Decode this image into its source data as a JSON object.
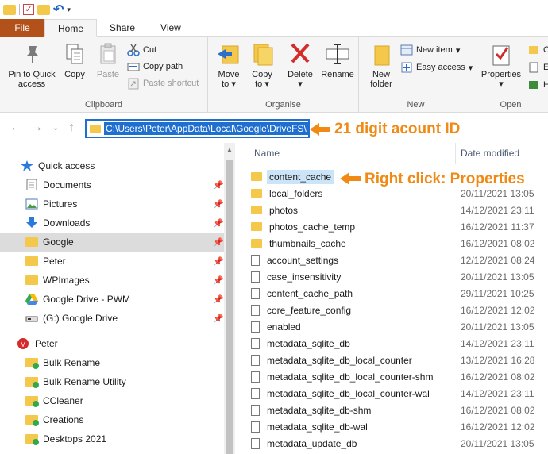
{
  "ribbon_tabs": {
    "file": "File",
    "home": "Home",
    "share": "Share",
    "view": "View"
  },
  "clipboard": {
    "pin_line1": "Pin to Quick",
    "pin_line2": "access",
    "copy": "Copy",
    "paste": "Paste",
    "cut": "Cut",
    "copy_path": "Copy path",
    "paste_shortcut": "Paste shortcut",
    "label": "Clipboard"
  },
  "organise": {
    "move_line1": "Move",
    "move_line2": "to",
    "copy_line1": "Copy",
    "copy_line2": "to",
    "delete": "Delete",
    "rename": "Rename",
    "label": "Organise"
  },
  "new_group": {
    "folder_line1": "New",
    "folder_line2": "folder",
    "new_item": "New item",
    "easy_access": "Easy access",
    "label": "New"
  },
  "open_group": {
    "properties": "Properties",
    "label": "Open",
    "cut_off_1": "O",
    "cut_off_2": "E",
    "cut_off_3": "H"
  },
  "address": {
    "path": "C:\\Users\\Peter\\AppData\\Local\\Google\\DriveFS\\"
  },
  "annotations": {
    "account_id": "21 digit acount ID",
    "right_click": "Right click: Properties"
  },
  "nav_pane": {
    "quick_access": "Quick access",
    "items": [
      {
        "label": "Documents",
        "pinned": true
      },
      {
        "label": "Pictures",
        "pinned": true
      },
      {
        "label": "Downloads",
        "pinned": true
      },
      {
        "label": "Google",
        "pinned": true
      },
      {
        "label": "Peter",
        "pinned": true
      },
      {
        "label": "WPImages",
        "pinned": true
      },
      {
        "label": "Google Drive - PWM",
        "pinned": true
      },
      {
        "label": "(G:) Google Drive",
        "pinned": true
      }
    ],
    "user": "Peter",
    "user_items": [
      "Bulk Rename",
      "Bulk Rename Utility",
      "CCleaner",
      "Creations",
      "Desktops 2021"
    ]
  },
  "columns": {
    "name": "Name",
    "date_modified": "Date modified"
  },
  "files": [
    {
      "name": "content_cache",
      "date": "",
      "type": "folder"
    },
    {
      "name": "local_folders",
      "date": "20/11/2021 13:05",
      "type": "folder"
    },
    {
      "name": "photos",
      "date": "14/12/2021 23:11",
      "type": "folder"
    },
    {
      "name": "photos_cache_temp",
      "date": "16/12/2021 11:37",
      "type": "folder"
    },
    {
      "name": "thumbnails_cache",
      "date": "16/12/2021 08:02",
      "type": "folder"
    },
    {
      "name": "account_settings",
      "date": "12/12/2021 08:24",
      "type": "file"
    },
    {
      "name": "case_insensitivity",
      "date": "20/11/2021 13:05",
      "type": "file"
    },
    {
      "name": "content_cache_path",
      "date": "29/11/2021 10:25",
      "type": "file"
    },
    {
      "name": "core_feature_config",
      "date": "16/12/2021 12:02",
      "type": "file"
    },
    {
      "name": "enabled",
      "date": "20/11/2021 13:05",
      "type": "file"
    },
    {
      "name": "metadata_sqlite_db",
      "date": "14/12/2021 23:11",
      "type": "file"
    },
    {
      "name": "metadata_sqlite_db_local_counter",
      "date": "13/12/2021 16:28",
      "type": "file"
    },
    {
      "name": "metadata_sqlite_db_local_counter-shm",
      "date": "16/12/2021 08:02",
      "type": "file"
    },
    {
      "name": "metadata_sqlite_db_local_counter-wal",
      "date": "14/12/2021 23:11",
      "type": "file"
    },
    {
      "name": "metadata_sqlite_db-shm",
      "date": "16/12/2021 08:02",
      "type": "file"
    },
    {
      "name": "metadata_sqlite_db-wal",
      "date": "16/12/2021 12:02",
      "type": "file"
    },
    {
      "name": "metadata_update_db",
      "date": "20/11/2021 13:05",
      "type": "file"
    }
  ],
  "colors": {
    "accent": "#1f6fd0",
    "file_tab": "#b3511a",
    "annotation": "#f08a14",
    "folder": "#f3c84b"
  }
}
